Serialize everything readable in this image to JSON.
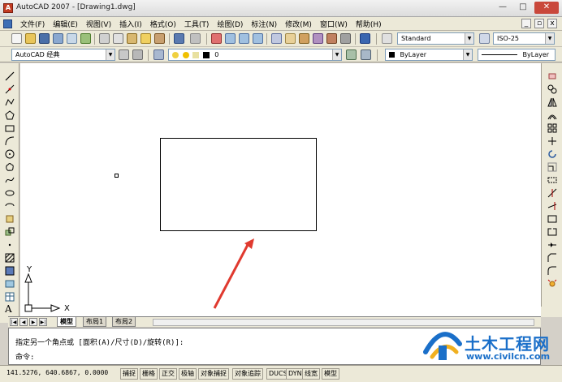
{
  "window": {
    "title": "AutoCAD 2007 - [Drawing1.dwg]",
    "minimize": "—",
    "maximize": "□",
    "close": "✕"
  },
  "menu": {
    "items": [
      "文件(F)",
      "编辑(E)",
      "视图(V)",
      "插入(I)",
      "格式(O)",
      "工具(T)",
      "绘图(D)",
      "标注(N)",
      "修改(M)",
      "窗口(W)",
      "帮助(H)"
    ],
    "mdi_minimize": "_",
    "mdi_restore": "▫",
    "mdi_close": "x"
  },
  "toolbar": {
    "text_style": "Standard",
    "dim_style": "ISO-25",
    "workspace": "AutoCAD 经典",
    "layer": "0",
    "color": "ByLayer",
    "linetype": "ByLayer"
  },
  "ucs": {
    "y_label": "Y",
    "x_label": "X"
  },
  "tabs": {
    "model": "模型",
    "layout1": "布局1",
    "layout2": "布局2"
  },
  "command": {
    "prompt_line": "指定另一个角点或 [面积(A)/尺寸(D)/旋转(R)]:",
    "input_label": "命令:"
  },
  "status": {
    "coordinates": "141.5276, 640.6867, 0.0000",
    "buttons": [
      "捕捉",
      "栅格",
      "正交",
      "极轴",
      "对象捕捉",
      "对象追踪",
      "DUCS",
      "DYN",
      "线宽",
      "模型"
    ]
  },
  "watermark": {
    "title": "土木工程网",
    "url": "www.civilcn.com"
  },
  "colors": {
    "annotation_arrow": "#e03a2f",
    "watermark_blue": "#1a6fc9"
  }
}
